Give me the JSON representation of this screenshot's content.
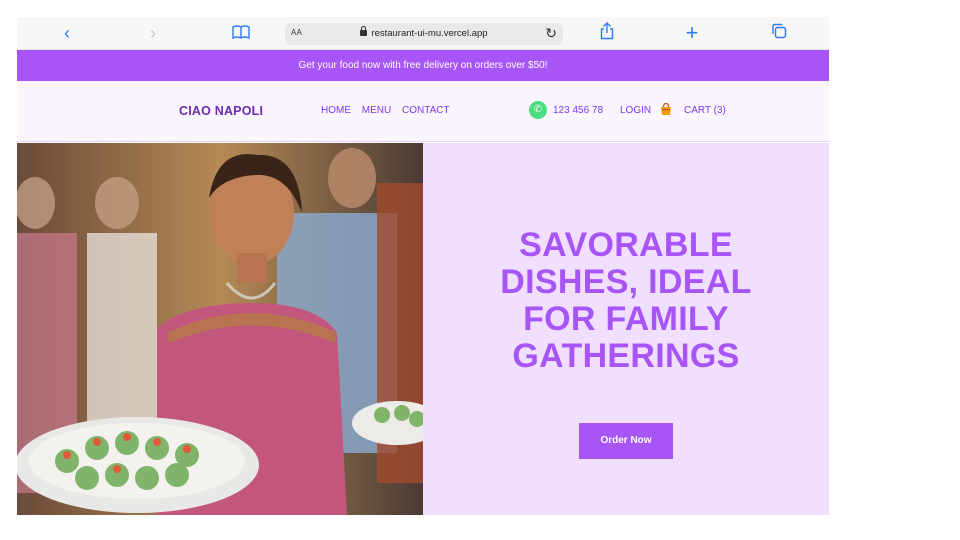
{
  "browser": {
    "url": "restaurant-ui-mu.vercel.app",
    "aa_label": "AA"
  },
  "promo": {
    "text": "Get your food now with free delivery on orders over $50!"
  },
  "nav": {
    "brand": "CIAO NAPOLI",
    "links": [
      "HOME",
      "MENU",
      "CONTACT"
    ],
    "phone": "123 456 78",
    "login": "LOGIN",
    "cart": "CART (3)"
  },
  "hero": {
    "headline_lines": [
      "SAVORABLE",
      "DISHES, IDEAL",
      "FOR FAMILY",
      "GATHERINGS"
    ],
    "cta": "Order Now"
  },
  "colors": {
    "accent": "#a855f7",
    "hero_bg": "#f0dfff",
    "nav_bg": "#fbf5ff",
    "phone_icon": "#4ade80"
  }
}
